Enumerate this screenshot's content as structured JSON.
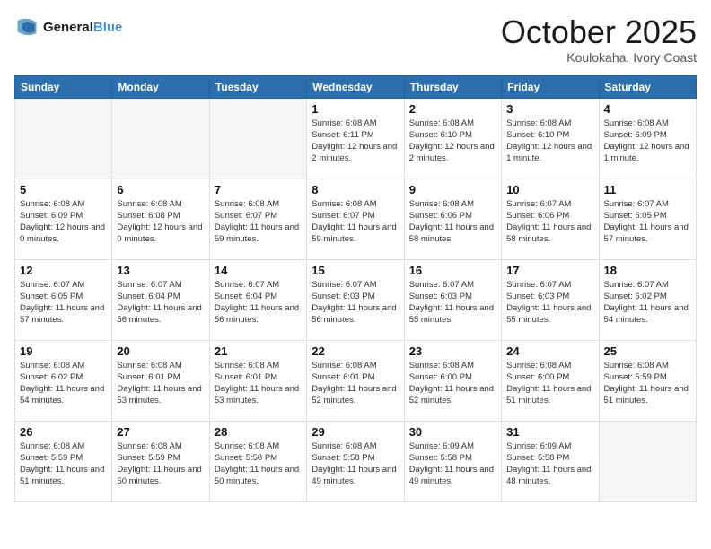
{
  "header": {
    "logo_line1": "General",
    "logo_line2": "Blue",
    "month": "October 2025",
    "location": "Koulokaha, Ivory Coast"
  },
  "weekdays": [
    "Sunday",
    "Monday",
    "Tuesday",
    "Wednesday",
    "Thursday",
    "Friday",
    "Saturday"
  ],
  "weeks": [
    [
      {
        "day": "",
        "info": ""
      },
      {
        "day": "",
        "info": ""
      },
      {
        "day": "",
        "info": ""
      },
      {
        "day": "1",
        "info": "Sunrise: 6:08 AM\nSunset: 6:11 PM\nDaylight: 12 hours and 2 minutes."
      },
      {
        "day": "2",
        "info": "Sunrise: 6:08 AM\nSunset: 6:10 PM\nDaylight: 12 hours and 2 minutes."
      },
      {
        "day": "3",
        "info": "Sunrise: 6:08 AM\nSunset: 6:10 PM\nDaylight: 12 hours and 1 minute."
      },
      {
        "day": "4",
        "info": "Sunrise: 6:08 AM\nSunset: 6:09 PM\nDaylight: 12 hours and 1 minute."
      }
    ],
    [
      {
        "day": "5",
        "info": "Sunrise: 6:08 AM\nSunset: 6:09 PM\nDaylight: 12 hours and 0 minutes."
      },
      {
        "day": "6",
        "info": "Sunrise: 6:08 AM\nSunset: 6:08 PM\nDaylight: 12 hours and 0 minutes."
      },
      {
        "day": "7",
        "info": "Sunrise: 6:08 AM\nSunset: 6:07 PM\nDaylight: 11 hours and 59 minutes."
      },
      {
        "day": "8",
        "info": "Sunrise: 6:08 AM\nSunset: 6:07 PM\nDaylight: 11 hours and 59 minutes."
      },
      {
        "day": "9",
        "info": "Sunrise: 6:08 AM\nSunset: 6:06 PM\nDaylight: 11 hours and 58 minutes."
      },
      {
        "day": "10",
        "info": "Sunrise: 6:07 AM\nSunset: 6:06 PM\nDaylight: 11 hours and 58 minutes."
      },
      {
        "day": "11",
        "info": "Sunrise: 6:07 AM\nSunset: 6:05 PM\nDaylight: 11 hours and 57 minutes."
      }
    ],
    [
      {
        "day": "12",
        "info": "Sunrise: 6:07 AM\nSunset: 6:05 PM\nDaylight: 11 hours and 57 minutes."
      },
      {
        "day": "13",
        "info": "Sunrise: 6:07 AM\nSunset: 6:04 PM\nDaylight: 11 hours and 56 minutes."
      },
      {
        "day": "14",
        "info": "Sunrise: 6:07 AM\nSunset: 6:04 PM\nDaylight: 11 hours and 56 minutes."
      },
      {
        "day": "15",
        "info": "Sunrise: 6:07 AM\nSunset: 6:03 PM\nDaylight: 11 hours and 56 minutes."
      },
      {
        "day": "16",
        "info": "Sunrise: 6:07 AM\nSunset: 6:03 PM\nDaylight: 11 hours and 55 minutes."
      },
      {
        "day": "17",
        "info": "Sunrise: 6:07 AM\nSunset: 6:03 PM\nDaylight: 11 hours and 55 minutes."
      },
      {
        "day": "18",
        "info": "Sunrise: 6:07 AM\nSunset: 6:02 PM\nDaylight: 11 hours and 54 minutes."
      }
    ],
    [
      {
        "day": "19",
        "info": "Sunrise: 6:08 AM\nSunset: 6:02 PM\nDaylight: 11 hours and 54 minutes."
      },
      {
        "day": "20",
        "info": "Sunrise: 6:08 AM\nSunset: 6:01 PM\nDaylight: 11 hours and 53 minutes."
      },
      {
        "day": "21",
        "info": "Sunrise: 6:08 AM\nSunset: 6:01 PM\nDaylight: 11 hours and 53 minutes."
      },
      {
        "day": "22",
        "info": "Sunrise: 6:08 AM\nSunset: 6:01 PM\nDaylight: 11 hours and 52 minutes."
      },
      {
        "day": "23",
        "info": "Sunrise: 6:08 AM\nSunset: 6:00 PM\nDaylight: 11 hours and 52 minutes."
      },
      {
        "day": "24",
        "info": "Sunrise: 6:08 AM\nSunset: 6:00 PM\nDaylight: 11 hours and 51 minutes."
      },
      {
        "day": "25",
        "info": "Sunrise: 6:08 AM\nSunset: 5:59 PM\nDaylight: 11 hours and 51 minutes."
      }
    ],
    [
      {
        "day": "26",
        "info": "Sunrise: 6:08 AM\nSunset: 5:59 PM\nDaylight: 11 hours and 51 minutes."
      },
      {
        "day": "27",
        "info": "Sunrise: 6:08 AM\nSunset: 5:59 PM\nDaylight: 11 hours and 50 minutes."
      },
      {
        "day": "28",
        "info": "Sunrise: 6:08 AM\nSunset: 5:58 PM\nDaylight: 11 hours and 50 minutes."
      },
      {
        "day": "29",
        "info": "Sunrise: 6:08 AM\nSunset: 5:58 PM\nDaylight: 11 hours and 49 minutes."
      },
      {
        "day": "30",
        "info": "Sunrise: 6:09 AM\nSunset: 5:58 PM\nDaylight: 11 hours and 49 minutes."
      },
      {
        "day": "31",
        "info": "Sunrise: 6:09 AM\nSunset: 5:58 PM\nDaylight: 11 hours and 48 minutes."
      },
      {
        "day": "",
        "info": ""
      }
    ]
  ]
}
